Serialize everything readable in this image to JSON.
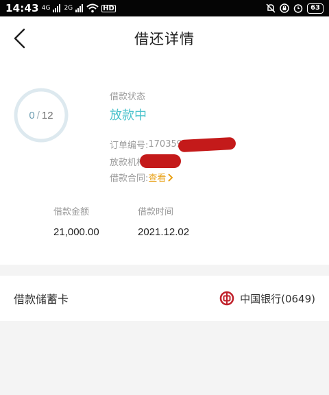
{
  "status_bar": {
    "time": "14:43",
    "network_1": "4G",
    "network_2": "2G",
    "hd": "HD",
    "battery": "63"
  },
  "header": {
    "title": "借还详情"
  },
  "detail": {
    "progress_paid": "0",
    "progress_sep": "/",
    "progress_total": "12",
    "status_label": "借款状态",
    "status_value": "放款中",
    "order_label": "订单编号: ",
    "order_value": "170359",
    "institution_label": "放款机构: ",
    "contract_label": "借款合同: ",
    "contract_link": "查看",
    "amount_label": "借款金额",
    "amount_value": "21,000.00",
    "time_label": "借款时间",
    "time_value": "2021.12.02"
  },
  "debit_card": {
    "label": "借款储蓄卡",
    "bank_name": "中国银行(0649)"
  },
  "colors": {
    "accent_teal": "#4cc3cc",
    "link_orange": "#e8a21a",
    "bank_red": "#c0212b",
    "redaction": "#c41a1a"
  }
}
